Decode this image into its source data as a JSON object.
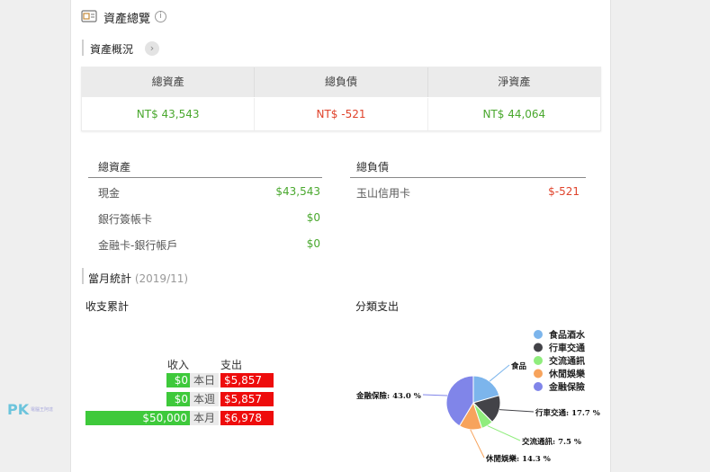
{
  "header": {
    "title": "資產總覽",
    "info_glyph": "i"
  },
  "overview": {
    "section_label": "資產概況",
    "arrow_glyph": "›",
    "headers": [
      "總資產",
      "總負債",
      "淨資產"
    ],
    "values": [
      "NT$ 43,543",
      "NT$ -521",
      "NT$ 44,064"
    ]
  },
  "assets": {
    "title": "總資產",
    "items": [
      {
        "name": "現金",
        "value": "$43,543"
      },
      {
        "name": "銀行簽帳卡",
        "value": "$0"
      },
      {
        "name": "金融卡-銀行帳戶",
        "value": "$0"
      }
    ]
  },
  "liabilities": {
    "title": "總負債",
    "items": [
      {
        "name": "玉山信用卡",
        "value": "$-521"
      }
    ]
  },
  "monthly": {
    "section_label": "當月統計",
    "period": "(2019/11)",
    "income_expense_title": "收支累計",
    "category_title": "分類支出",
    "col_income": "收入",
    "col_expense": "支出",
    "rows": [
      {
        "label": "本日",
        "income": "$0",
        "expense": "$5,857"
      },
      {
        "label": "本週",
        "income": "$0",
        "expense": "$5,857"
      },
      {
        "label": "本月",
        "income": "$50,000",
        "expense": "$6,978"
      }
    ]
  },
  "watermark": {
    "logo": "PK",
    "sub": "電腦王阿達"
  },
  "chart_data": {
    "type": "pie",
    "title": "分類支出",
    "legend": [
      "食品酒水",
      "行車交通",
      "交流通訊",
      "休閒娛樂",
      "金融保險"
    ],
    "legend_position": "right-top",
    "slices": [
      {
        "name": "食品酒水",
        "label": "食品",
        "value": 21.4,
        "color": "#7cb5ec"
      },
      {
        "name": "行車交通",
        "label": "行車交通: 17.7 %",
        "value": 17.7,
        "color": "#434348"
      },
      {
        "name": "交流通訊",
        "label": "交流通訊: 7.5 %",
        "value": 7.5,
        "color": "#90ed7d"
      },
      {
        "name": "休閒娛樂",
        "label": "休閒娛樂: 14.3 %",
        "value": 14.3,
        "color": "#f7a35c"
      },
      {
        "name": "金融保險",
        "label": "金融保險: 43.0 %",
        "value": 43.0,
        "color": "#8085e9"
      }
    ]
  }
}
